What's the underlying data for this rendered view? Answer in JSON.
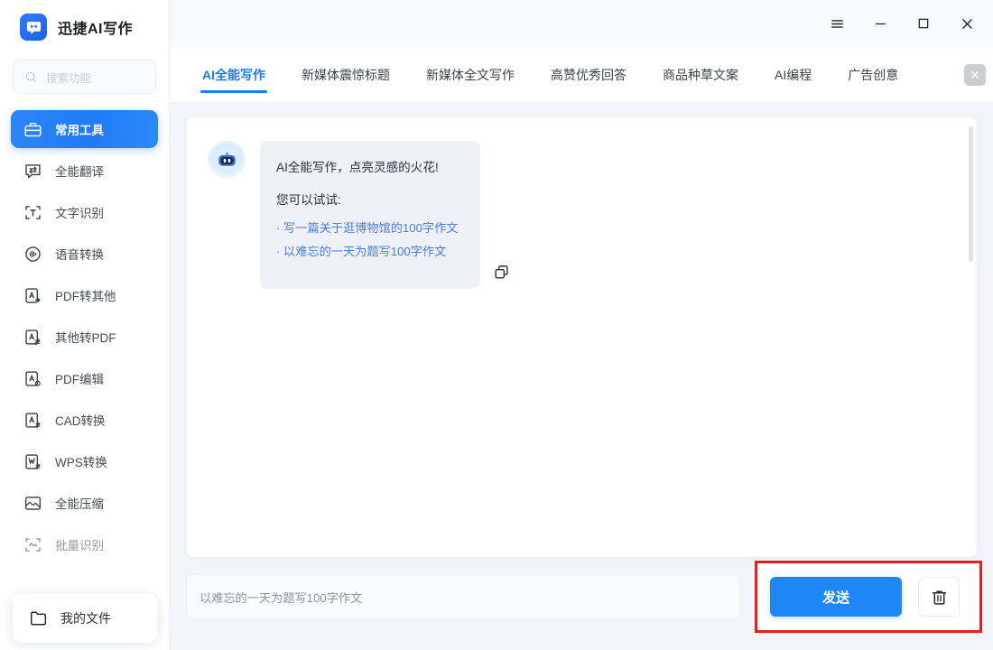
{
  "app": {
    "title": "迅捷AI写作",
    "logo_icon": "robot-chat-logo-icon"
  },
  "window_controls": [
    {
      "name": "menu-button",
      "icon": "hamburger-menu-icon"
    },
    {
      "name": "minimize-button",
      "icon": "minimize-icon"
    },
    {
      "name": "maximize-button",
      "icon": "maximize-square-icon"
    },
    {
      "name": "close-button",
      "icon": "close-x-icon"
    }
  ],
  "search": {
    "placeholder": "搜索功能",
    "icon": "search-icon"
  },
  "sidebar": {
    "items": [
      {
        "label": "常用工具",
        "icon": "toolbox-icon",
        "active": true
      },
      {
        "label": "全能翻译",
        "icon": "translate-icon",
        "active": false
      },
      {
        "label": "文字识别",
        "icon": "text-recognition-icon",
        "active": false
      },
      {
        "label": "语音转换",
        "icon": "voice-convert-icon",
        "active": false
      },
      {
        "label": "PDF转其他",
        "icon": "pdf-to-other-icon",
        "active": false
      },
      {
        "label": "其他转PDF",
        "icon": "other-to-pdf-icon",
        "active": false
      },
      {
        "label": "PDF编辑",
        "icon": "pdf-edit-icon",
        "active": false
      },
      {
        "label": "CAD转换",
        "icon": "cad-convert-icon",
        "active": false
      },
      {
        "label": "WPS转换",
        "icon": "wps-convert-icon",
        "active": false
      },
      {
        "label": "全能压缩",
        "icon": "compress-icon",
        "active": false
      },
      {
        "label": "批量识别",
        "icon": "batch-recognition-icon",
        "active": false
      }
    ],
    "my_files": {
      "label": "我的文件",
      "icon": "folder-icon"
    }
  },
  "tabs": {
    "items": [
      {
        "label": "AI全能写作",
        "active": true
      },
      {
        "label": "新媒体震惊标题",
        "active": false
      },
      {
        "label": "新媒体全文写作",
        "active": false
      },
      {
        "label": "高赞优秀回答",
        "active": false
      },
      {
        "label": "商品种草文案",
        "active": false
      },
      {
        "label": "AI编程",
        "active": false
      },
      {
        "label": "广告创意",
        "active": false
      }
    ],
    "close_icon": "close-x-icon"
  },
  "chat": {
    "avatar_icon": "ai-robot-avatar-icon",
    "message": {
      "headline": "AI全能写作，点亮灵感的火花!",
      "subhead": "您可以试试:",
      "suggestions": [
        "· 写一篇关于逛博物馆的100字作文",
        "· 以难忘的一天为题写100字作文"
      ]
    },
    "copy_icon": "copy-icon"
  },
  "composer": {
    "value": "以难忘的一天为题写100字作文",
    "placeholder": "以难忘的一天为题写100字作文"
  },
  "actions": {
    "send_label": "发送",
    "trash_icon": "trash-icon",
    "highlight_color": "#e81c20"
  },
  "colors": {
    "accent": "#1f7bf5",
    "send_button": "#1f87f5",
    "bubble_bg": "#eef1f8",
    "link": "#4a7fd6",
    "annotation": "#e81c20"
  }
}
